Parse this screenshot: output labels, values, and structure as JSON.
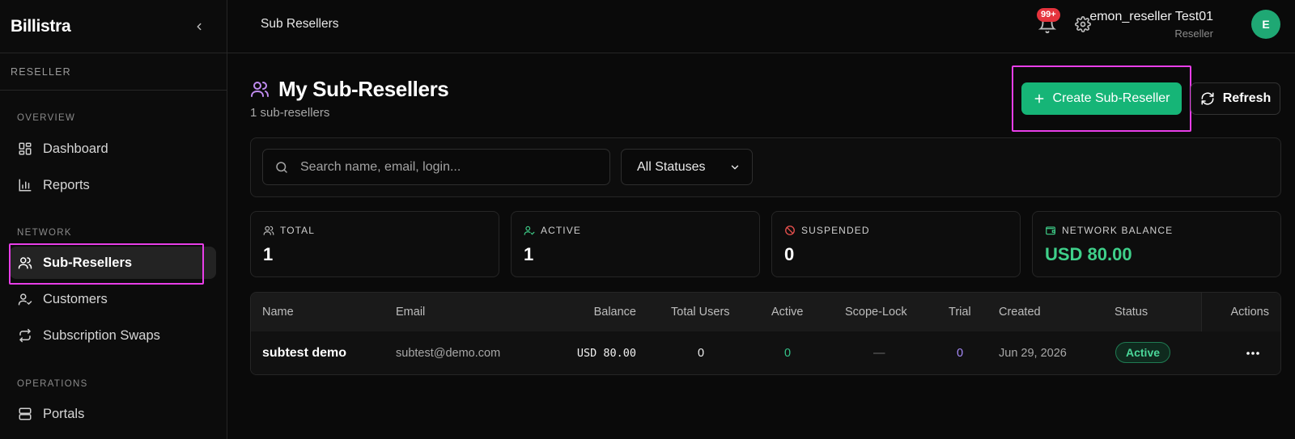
{
  "app": {
    "brand": "Billistra"
  },
  "sidebar": {
    "role_label": "RESELLER",
    "sections": [
      {
        "label": "OVERVIEW",
        "items": [
          {
            "label": "Dashboard",
            "icon": "dashboard-icon"
          },
          {
            "label": "Reports",
            "icon": "reports-icon"
          }
        ]
      },
      {
        "label": "NETWORK",
        "items": [
          {
            "label": "Sub-Resellers",
            "icon": "users-icon",
            "active": true
          },
          {
            "label": "Customers",
            "icon": "user-check-icon"
          },
          {
            "label": "Subscription Swaps",
            "icon": "swap-icon"
          }
        ]
      },
      {
        "label": "OPERATIONS",
        "items": [
          {
            "label": "Portals",
            "icon": "server-icon"
          }
        ]
      }
    ]
  },
  "topbar": {
    "breadcrumb": "Sub Resellers",
    "notification_count": "99+",
    "user_name": "emon_reseller Test01",
    "user_role": "Reseller",
    "avatar_initial": "E"
  },
  "page": {
    "title": "My Sub-Resellers",
    "subtitle": "1 sub-resellers",
    "create_button": "Create Sub-Reseller",
    "refresh_button": "Refresh"
  },
  "filters": {
    "search_placeholder": "Search name, email, login...",
    "status_selected": "All Statuses"
  },
  "stats": [
    {
      "label": "TOTAL",
      "value": "1",
      "icon": "users-icon"
    },
    {
      "label": "ACTIVE",
      "value": "1",
      "icon": "user-check-icon"
    },
    {
      "label": "SUSPENDED",
      "value": "0",
      "icon": "ban-icon"
    },
    {
      "label": "NETWORK BALANCE",
      "value": "USD 80.00",
      "icon": "wallet-icon"
    }
  ],
  "table": {
    "columns": [
      "Name",
      "Email",
      "Balance",
      "Total Users",
      "Active",
      "Scope-Lock",
      "Trial",
      "Created",
      "Status",
      "Actions"
    ],
    "rows": [
      {
        "name": "subtest demo",
        "email": "subtest@demo.com",
        "balance": "USD 80.00",
        "total_users": "0",
        "active": "0",
        "scope_lock": "—",
        "trial": "0",
        "created": "Jun 29, 2026",
        "status": "Active"
      }
    ]
  },
  "colors": {
    "accent": "#16b577",
    "highlight": "#e83ee8",
    "danger": "#e5343d",
    "trial": "#a78bfa",
    "active_count": "#34c48a"
  }
}
